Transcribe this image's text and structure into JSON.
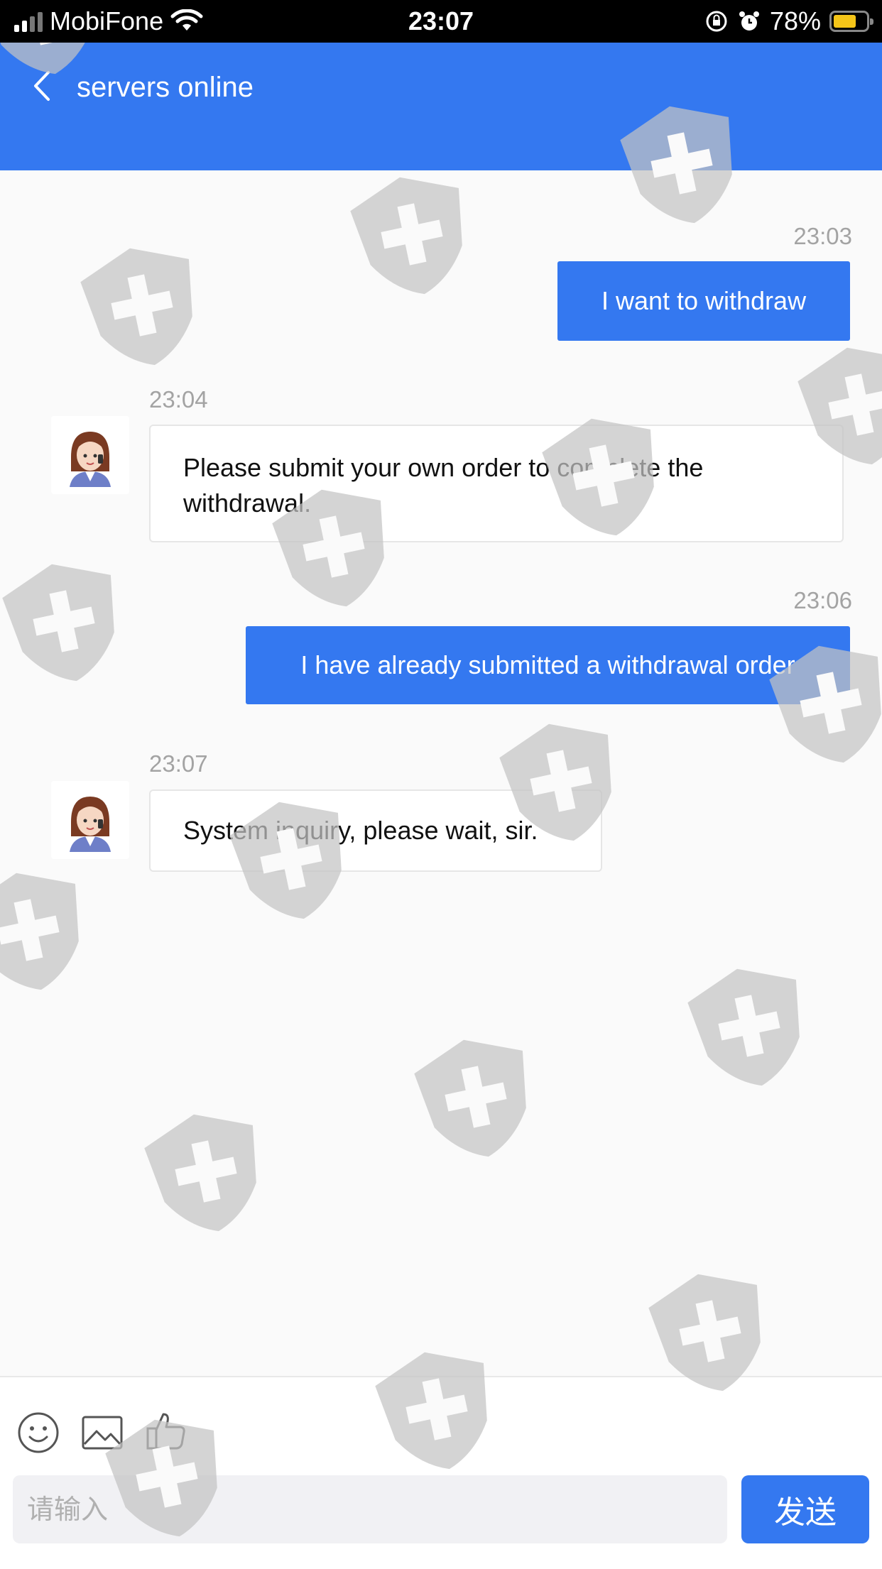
{
  "status_bar": {
    "carrier": "MobiFone",
    "time": "23:07",
    "battery": "78%"
  },
  "header": {
    "title": "servers online",
    "back_icon": "chevron-left-icon"
  },
  "messages": [
    {
      "direction": "outgoing",
      "time": "23:03",
      "text": "I want to withdraw"
    },
    {
      "direction": "incoming",
      "time": "23:04",
      "text": "Please submit your own order to complete the withdrawal."
    },
    {
      "direction": "outgoing",
      "time": "23:06",
      "text": "I have already submitted a withdrawal order"
    },
    {
      "direction": "incoming",
      "time": "23:07",
      "text": "System inquiry, please wait, sir."
    }
  ],
  "toolbar": {
    "icons": [
      "emoji-icon",
      "image-icon",
      "thumbs-up-icon"
    ]
  },
  "composer": {
    "placeholder": "请输入",
    "send_label": "发送"
  },
  "colors": {
    "accent": "#3478f0",
    "background": "#fafafa",
    "watermark": "#c8c8c8"
  }
}
